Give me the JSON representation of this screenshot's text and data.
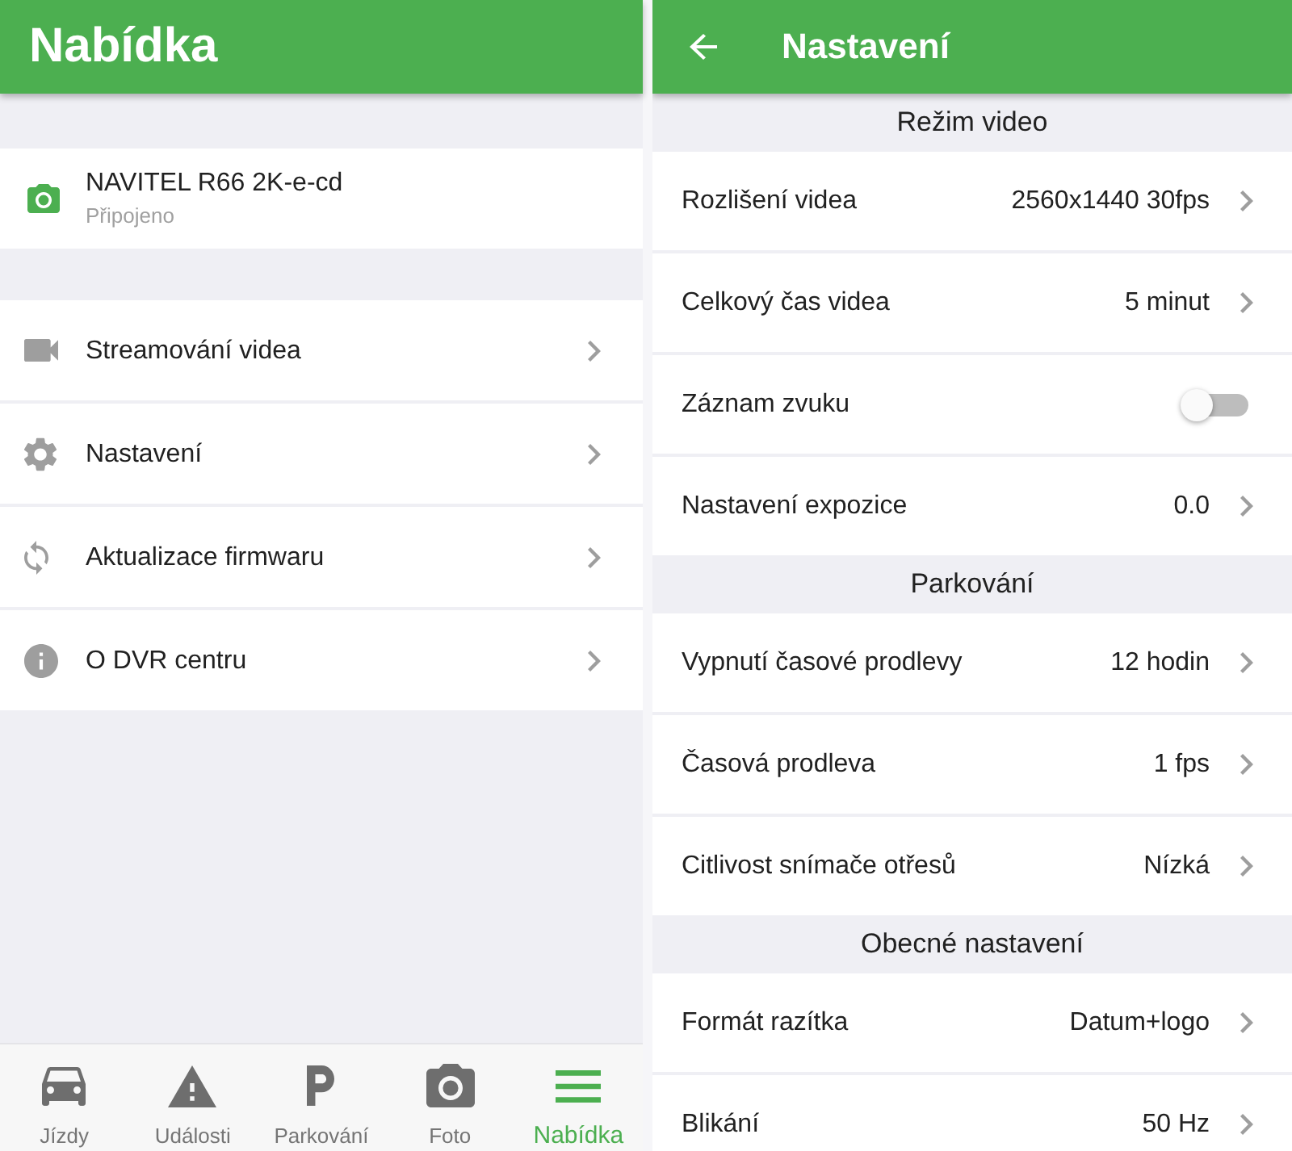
{
  "left_screen": {
    "title": "Nabídka",
    "device": {
      "name": "NAVITEL R66 2K-e-cd",
      "status": "Připojeno"
    },
    "menu_items": [
      {
        "label": "Streamování videa"
      },
      {
        "label": "Nastavení"
      },
      {
        "label": "Aktualizace firmwaru"
      },
      {
        "label": "O DVR centru"
      }
    ],
    "bottom_nav": [
      {
        "label": "Jízdy",
        "selected": false
      },
      {
        "label": "Události",
        "selected": false
      },
      {
        "label": "Parkování",
        "selected": false
      },
      {
        "label": "Foto",
        "selected": false
      },
      {
        "label": "Nabídka",
        "selected": true
      }
    ]
  },
  "right_screen": {
    "title": "Nastavení",
    "sections": [
      {
        "title": "Režim video",
        "rows": [
          {
            "kind": "value",
            "label": "Rozlišení videa",
            "value": "2560x1440 30fps"
          },
          {
            "kind": "value",
            "label": "Celkový čas videa",
            "value": "5 minut"
          },
          {
            "kind": "toggle",
            "label": "Záznam zvuku",
            "on": false
          },
          {
            "kind": "value",
            "label": "Nastavení expozice",
            "value": "0.0"
          }
        ]
      },
      {
        "title": "Parkování",
        "rows": [
          {
            "kind": "value",
            "label": "Vypnutí časové prodlevy",
            "value": "12 hodin"
          },
          {
            "kind": "value",
            "label": "Časová prodleva",
            "value": "1 fps"
          },
          {
            "kind": "value",
            "label": "Citlivost snímače otřesů",
            "value": "Nízká"
          }
        ]
      },
      {
        "title": "Obecné nastavení",
        "rows": [
          {
            "kind": "value",
            "label": "Formát razítka",
            "value": "Datum+logo"
          },
          {
            "kind": "value",
            "label": "Blikání",
            "value": "50 Hz"
          }
        ]
      }
    ]
  }
}
